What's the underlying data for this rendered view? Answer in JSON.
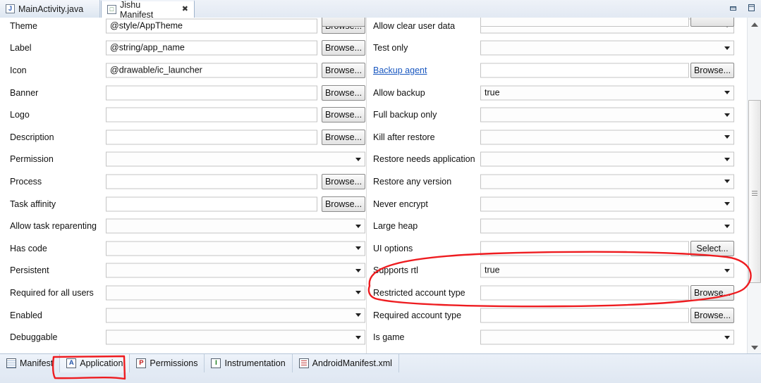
{
  "window": {
    "minimize_icon": "minimize-icon",
    "maximize_icon": "maximize-icon"
  },
  "editor_tabs": [
    {
      "label": "MainActivity.java",
      "icon": "java-file-icon",
      "glyph": "J",
      "active": false,
      "closable": false
    },
    {
      "label": "Jishu Manifest",
      "icon": "android-manifest-icon",
      "glyph": "□",
      "active": true,
      "closable": true,
      "close_glyph": "✖"
    }
  ],
  "left_column": [
    {
      "label": "Theme",
      "control": "text",
      "value": "@style/AppTheme",
      "button": "Browse..."
    },
    {
      "label": "Label",
      "control": "text",
      "value": "@string/app_name",
      "button": "Browse..."
    },
    {
      "label": "Icon",
      "control": "text",
      "value": "@drawable/ic_launcher",
      "button": "Browse..."
    },
    {
      "label": "Banner",
      "control": "text",
      "value": "",
      "button": "Browse..."
    },
    {
      "label": "Logo",
      "control": "text",
      "value": "",
      "button": "Browse..."
    },
    {
      "label": "Description",
      "control": "text",
      "value": "",
      "button": "Browse..."
    },
    {
      "label": "Permission",
      "control": "combo",
      "value": "",
      "button": ""
    },
    {
      "label": "Process",
      "control": "text",
      "value": "",
      "button": "Browse..."
    },
    {
      "label": "Task affinity",
      "control": "text",
      "value": "",
      "button": "Browse..."
    },
    {
      "label": "Allow task reparenting",
      "control": "combo",
      "value": "",
      "button": ""
    },
    {
      "label": "Has code",
      "control": "combo",
      "value": "",
      "button": ""
    },
    {
      "label": "Persistent",
      "control": "combo",
      "value": "",
      "button": ""
    },
    {
      "label": "Required for all users",
      "control": "combo",
      "value": "",
      "button": ""
    },
    {
      "label": "Enabled",
      "control": "combo",
      "value": "",
      "button": ""
    },
    {
      "label": "Debuggable",
      "control": "combo",
      "value": "",
      "button": ""
    }
  ],
  "right_column": [
    {
      "label": "Allow clear user data",
      "control": "combo",
      "value": "",
      "button": "",
      "link": false
    },
    {
      "label": "Test only",
      "control": "combo",
      "value": "",
      "button": "",
      "link": false
    },
    {
      "label": "Backup agent",
      "control": "text",
      "value": "",
      "button": "Browse...",
      "link": true
    },
    {
      "label": "Allow backup",
      "control": "combo",
      "value": "true",
      "button": "",
      "link": false
    },
    {
      "label": "Full backup only",
      "control": "combo",
      "value": "",
      "button": "",
      "link": false
    },
    {
      "label": "Kill after restore",
      "control": "combo",
      "value": "",
      "button": "",
      "link": false
    },
    {
      "label": "Restore needs application",
      "control": "combo",
      "value": "",
      "button": "",
      "link": false
    },
    {
      "label": "Restore any version",
      "control": "combo",
      "value": "",
      "button": "",
      "link": false
    },
    {
      "label": "Never encrypt",
      "control": "combo",
      "value": "",
      "button": "",
      "link": false
    },
    {
      "label": "Large heap",
      "control": "combo",
      "value": "",
      "button": "",
      "link": false
    },
    {
      "label": "UI options",
      "control": "text",
      "value": "",
      "button": "Select...",
      "link": false
    },
    {
      "label": "Supports rtl",
      "control": "combo",
      "value": "true",
      "button": "",
      "link": false
    },
    {
      "label": "Restricted account type",
      "control": "text",
      "value": "",
      "button": "Browse...",
      "link": false
    },
    {
      "label": "Required account type",
      "control": "text",
      "value": "",
      "button": "Browse...",
      "link": false
    },
    {
      "label": "Is game",
      "control": "combo",
      "value": "",
      "button": "",
      "link": false
    }
  ],
  "page_tabs": [
    {
      "label": "Manifest",
      "glyph": "≡",
      "icon": "manifest-page-icon",
      "icon_style": "grid",
      "active": false
    },
    {
      "label": "Application",
      "glyph": "A",
      "icon": "application-page-icon",
      "icon_style": "blue",
      "active": true
    },
    {
      "label": "Permissions",
      "glyph": "P",
      "icon": "permissions-page-icon",
      "icon_style": "red",
      "active": false
    },
    {
      "label": "Instrumentation",
      "glyph": "I",
      "icon": "instrumentation-page-icon",
      "icon_style": "green",
      "active": false
    },
    {
      "label": "AndroidManifest.xml",
      "glyph": "≡",
      "icon": "xml-source-page-icon",
      "icon_style": "lines",
      "active": false
    }
  ],
  "annotations": {
    "color": "#ee1c20",
    "shapes": [
      "ellipse-around-supports-rtl-row",
      "rounded-rect-around-application-tab"
    ]
  },
  "scrollbar": {
    "up_arrow": "scroll-up-arrow",
    "down_arrow": "scroll-down-arrow",
    "thumb": "scroll-thumb"
  }
}
